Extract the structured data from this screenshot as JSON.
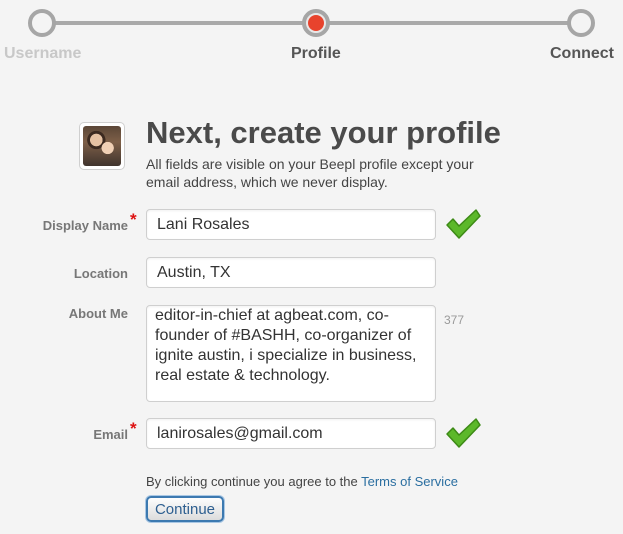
{
  "stepper": {
    "steps": [
      {
        "label": "Username",
        "state": "done"
      },
      {
        "label": "Profile",
        "state": "current"
      },
      {
        "label": "Connect",
        "state": "upcoming"
      }
    ],
    "current_dot_color": "#e8432d"
  },
  "header": {
    "title": "Next, create your profile",
    "subtitle": "All fields are visible on your Beepl profile except your email address, which we never display."
  },
  "form": {
    "display_name": {
      "label": "Display Name",
      "required": true,
      "value": "Lani Rosales",
      "valid": true
    },
    "location": {
      "label": "Location",
      "value": "Austin, TX"
    },
    "about_me": {
      "label": "About Me",
      "value": "editor-in-chief at agbeat.com, co-founder of #BASHH, co-organizer of ignite austin, i specialize in business, real estate & technology.",
      "chars_remaining": "377"
    },
    "email": {
      "label": "Email",
      "required": true,
      "value": "lanirosales@gmail.com",
      "valid": true
    },
    "required_marker": "*"
  },
  "footer": {
    "terms_prefix": "By clicking continue you agree to the ",
    "terms_link": "Terms of Service",
    "continue_label": "Continue"
  },
  "colors": {
    "check_green": "#5cb82a",
    "link_blue": "#2a6ea0"
  }
}
